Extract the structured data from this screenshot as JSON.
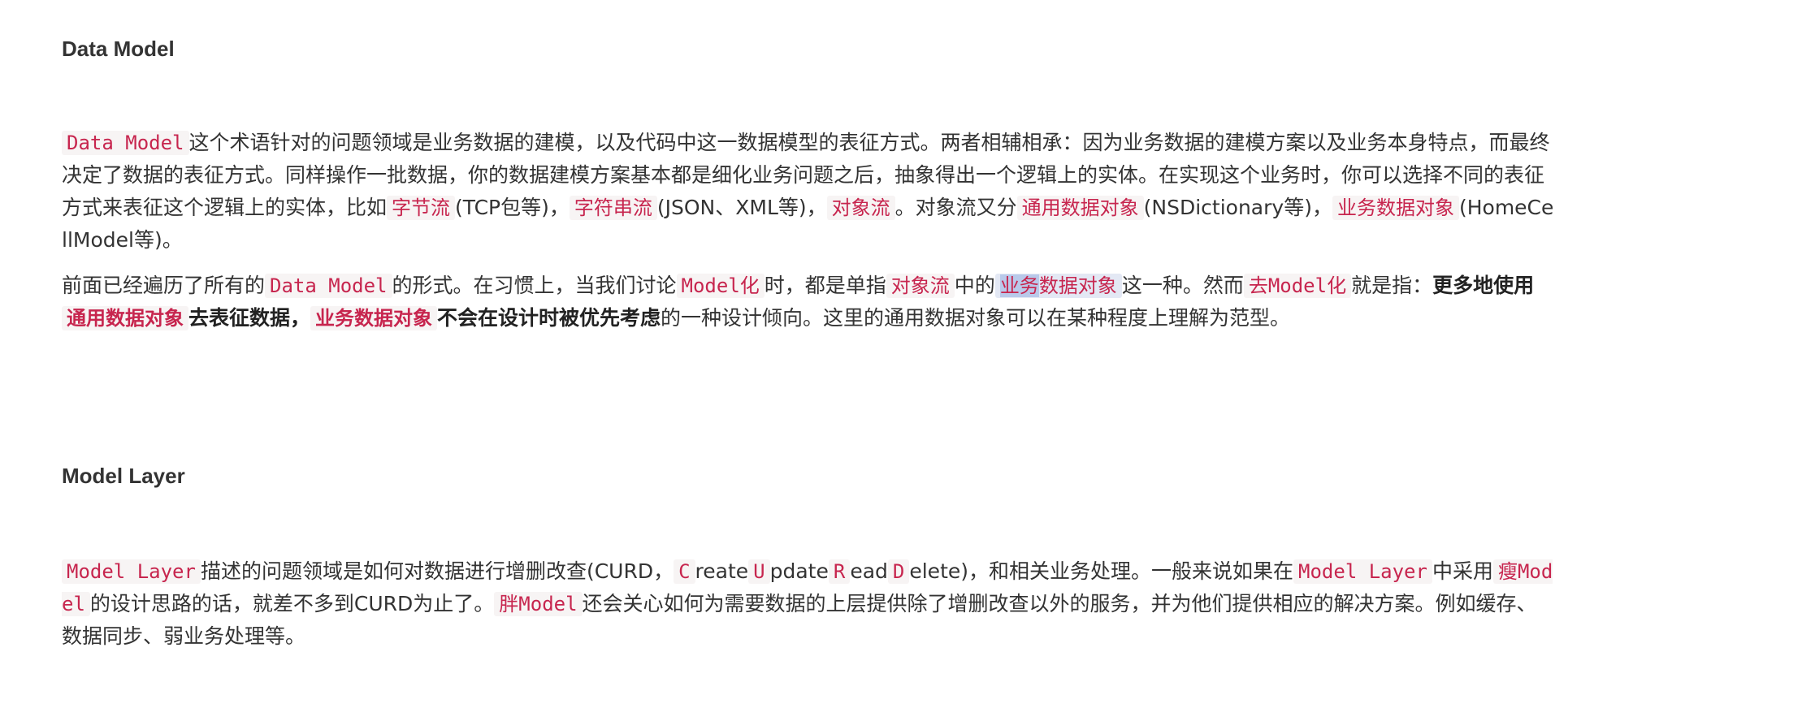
{
  "section1": {
    "heading": "Data Model",
    "p1": {
      "c1": "Data Model",
      "t1": "这个术语针对的问题领域是业务数据的建模，以及代码中这一数据模型的表征方式。两者相辅相承：因为业务数据的建模方案以及业务本身特点，而最终决定了数据的表征方式。同样操作一批数据，你的数据建模方案基本都是细化业务问题之后，抽象得出一个逻辑上的实体。在实现这个业务时，你可以选择不同的表征方式来表征这个逻辑上的实体，比如",
      "c2": "字节流",
      "t2": "(TCP包等)，",
      "c3": "字符串流",
      "t3": "(JSON、XML等)，",
      "c4": "对象流",
      "t4": "。对象流又分",
      "c5": "通用数据对象",
      "t5": "(NSDictionary等)，",
      "c6": "业务数据对象",
      "t6": "(HomeCellModel等)。"
    },
    "p2": {
      "t1": "前面已经遍历了所有的",
      "c1": "Data Model",
      "t2": "的形式。在习惯上，当我们讨论",
      "c2": "Model化",
      "t3": "时，都是单指",
      "c3": "对象流",
      "t4": "中的",
      "c4a": "业务",
      "c4b": "数据对象",
      "t5": "这一种。然而",
      "c5": "去Model化",
      "t6": "就是指：",
      "b1": "更多地使用",
      "bc1": "通用数据对象",
      "b2": "去表征数据，",
      "bc2": "业务数据对象",
      "b3": "不会在设计时被优先考虑",
      "t7": "的一种设计倾向。这里的通用数据对象可以在某种程度上理解为范型。"
    }
  },
  "section2": {
    "heading": "Model Layer",
    "p1": {
      "c1": "Model Layer",
      "t1": "描述的问题领域是如何对数据进行增删改查(CURD，",
      "c2": "C",
      "t2": "reate",
      "c3": "U",
      "t3": "pdate",
      "c4": "R",
      "t4": "ead",
      "c5": "D",
      "t5": "elete)，和相关业务处理。一般来说如果在",
      "c6": "Model Layer",
      "t6": "中采用",
      "c7": "瘦Model",
      "t7": "的设计思路的话，就差不多到CURD为止了。",
      "c8": "胖Model",
      "t8": "还会关心如何为需要数据的上层提供除了增删改查以外的服务，并为他们提供相应的解决方案。例如缓存、数据同步、弱业务处理等。"
    }
  }
}
